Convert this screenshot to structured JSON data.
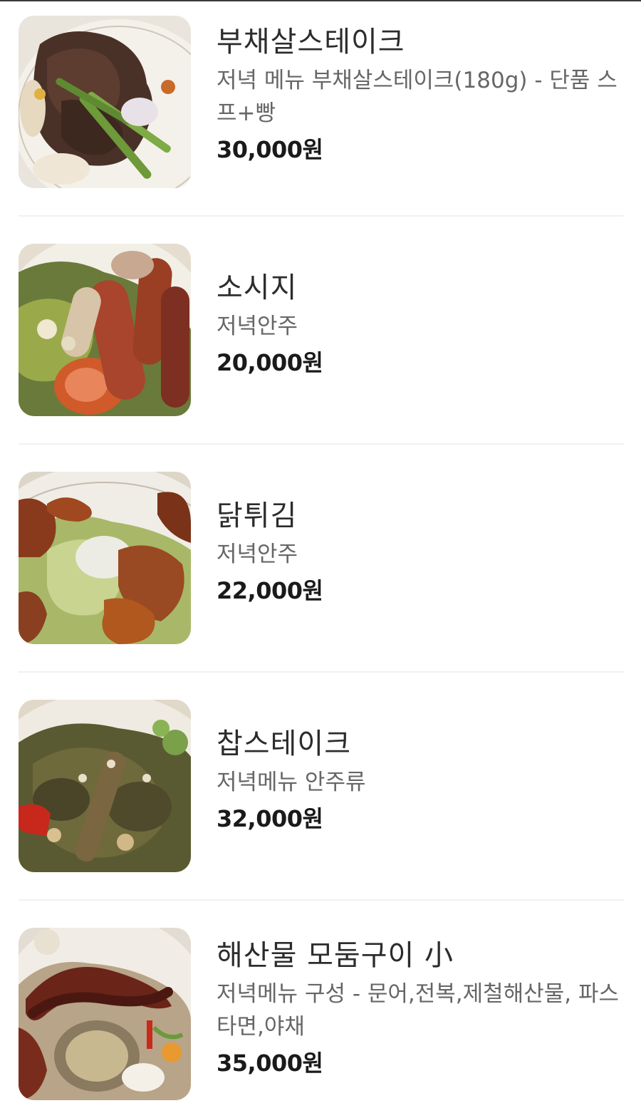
{
  "menu": {
    "items": [
      {
        "name": "부채살스테이크",
        "description": "저녁 메뉴 부채살스테이크(180g) - 단품 스프+빵",
        "price": "30,000원",
        "image": "steak-asparagus-photo"
      },
      {
        "name": "소시지",
        "description": "저녁안주",
        "price": "20,000원",
        "image": "sausage-salad-photo"
      },
      {
        "name": "닭튀김",
        "description": "저녁안주",
        "price": "22,000원",
        "image": "fried-chicken-salad-photo"
      },
      {
        "name": "찹스테이크",
        "description": "저녁메뉴 안주류",
        "price": "32,000원",
        "image": "chop-steak-photo"
      },
      {
        "name": "해산물 모둠구이 小",
        "description": "저녁메뉴 구성 - 문어,전복,제철해산물, 파스타면,야채",
        "price": "35,000원",
        "image": "grilled-seafood-photo"
      }
    ]
  },
  "colors": {
    "name_text": "#2c2c2c",
    "desc_text": "#666666",
    "price_text": "#1a1a1a",
    "divider": "#f1f1f1"
  }
}
